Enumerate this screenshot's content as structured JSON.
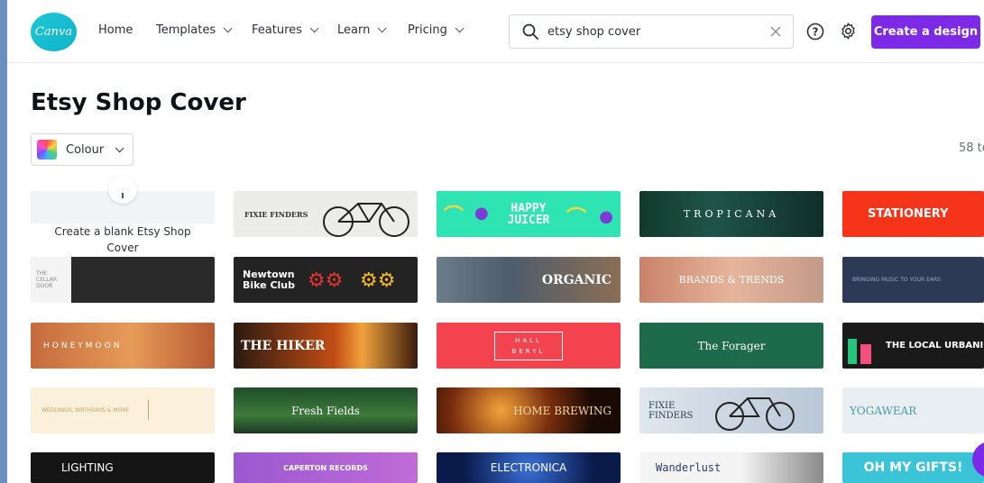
{
  "header": {
    "logo": "Canva",
    "nav": [
      {
        "label": "Home",
        "dropdown": false
      },
      {
        "label": "Templates",
        "dropdown": true
      },
      {
        "label": "Features",
        "dropdown": true
      },
      {
        "label": "Learn",
        "dropdown": true
      },
      {
        "label": "Pricing",
        "dropdown": true
      }
    ],
    "search": {
      "value": "etsy shop cover",
      "placeholder": ""
    },
    "create_label": "Create a design",
    "accent": "#7d2ae8"
  },
  "main": {
    "title": "Etsy Shop Cover",
    "colour_filter": "Colour",
    "count_text": "58 te",
    "blank_label": "Create a blank Etsy Shop Cover"
  },
  "templates": [
    {
      "label": "FIXIE FINDERS"
    },
    {
      "label": "HAPPY JUICER"
    },
    {
      "label": "TROPICANA"
    },
    {
      "label": "STATIONERY"
    },
    {
      "label": "THE CELLAR DOOR"
    },
    {
      "label": "Newtown Bike Club"
    },
    {
      "label": "ORGANIC"
    },
    {
      "label": "BRANDS & TRENDS"
    },
    {
      "label": "BRINGING MUSIC TO YOUR EARS"
    },
    {
      "label": "HONEYMOON"
    },
    {
      "label": "THE HIKER"
    },
    {
      "label": "HALL BERYL"
    },
    {
      "label": "The Forager"
    },
    {
      "label": "THE LOCAL URBANIST"
    },
    {
      "label": "WEDDINGS, BIRTHDAYS & MORE"
    },
    {
      "label": "Fresh Fields"
    },
    {
      "label": "HOME BREWING"
    },
    {
      "label": "FIXIE FINDERS"
    },
    {
      "label": "YOGAWEAR"
    },
    {
      "label": "LIGHTING"
    },
    {
      "label": "CAPERTON RECORDS"
    },
    {
      "label": "ELECTRONICA"
    },
    {
      "label": "Wanderlust"
    },
    {
      "label": "OH MY GIFTS!"
    }
  ]
}
